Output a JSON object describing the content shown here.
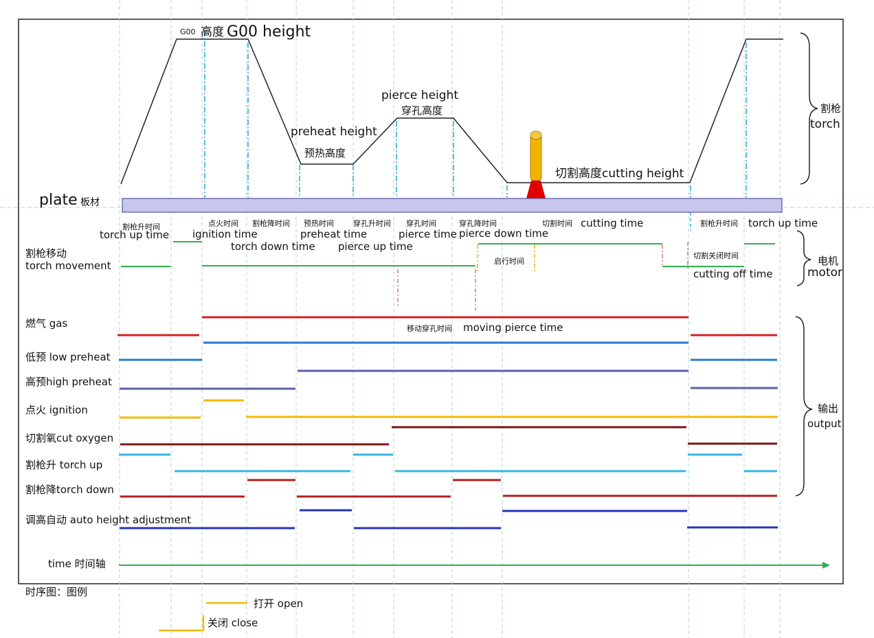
{
  "colors": {
    "profile": "#222222",
    "grid": "#a8d8cc",
    "plate_fill": "#c7c7ee",
    "plate_stroke": "#555599",
    "marker_blue": "#29a3d6",
    "marker_yellow": "#f2b200",
    "marker_red": "#e05050",
    "motor": "#2fb04a",
    "gas": "#d42020",
    "low_preheat": "#2a79c7",
    "high_preheat": "#5b5fa8",
    "ignition": "#f5b800",
    "cut_oxygen": "#7a1515",
    "torch_up": "#33b6e0",
    "torch_down": "#b01e1e",
    "auto_height": "#2433b8",
    "time_axis": "#2fb04a"
  },
  "top": {
    "g00_small": "G00",
    "g00_cn": "高度",
    "g00_en": "G00 height",
    "pierce_en": "pierce height",
    "pierce_cn": "穿孔高度",
    "preheat_en": "preheat height",
    "preheat_cn": "预热高度",
    "cutting_height": "切割高度cutting height",
    "plate_en": "plate",
    "plate_cn": "板材"
  },
  "phases": {
    "up_cn": "割枪升时间",
    "up_en": "torch up time",
    "ign_cn": "点火时间",
    "ign_en": "ignition time",
    "down_cn": "割枪降时间",
    "down_en": "torch down time",
    "preheat_cn": "预热时间",
    "preheat_en": "preheat time",
    "pup_cn": "穿孔升时间",
    "pup_en": "pierce up time",
    "pierce_cn": "穿孔时间",
    "pierce_en": "pierce time",
    "pdown_cn": "穿孔降时间",
    "pdown_en": "pierce down time",
    "cut_cn": "切割时间",
    "cut_en": "cutting time",
    "up2_cn": "割枪升时间",
    "up2_en": "torch up time",
    "startup_cn": "启行时间",
    "cutoff_cn": "切割关闭时间",
    "cutoff_en": "cutting off time",
    "moving_cn": "移动穿孔时间",
    "moving_en": "moving pierce time"
  },
  "signals": {
    "motor_cn": "割枪移动",
    "motor_en": "torch movement",
    "gas": "燃气 gas",
    "low": "低预 low preheat",
    "high": "高预high preheat",
    "ign": "点火 ignition",
    "cut": "切割氧cut oxygen",
    "up": "割枪升 torch up",
    "down": "割枪降torch down",
    "auto": "调高自动 auto height adjustment",
    "time": "time 时间轴"
  },
  "groups": {
    "torch_cn": "割枪",
    "torch_en": "torch",
    "motor_cn": "电机",
    "motor_en": "motor",
    "output_cn": "输出",
    "output_en": "output"
  },
  "legend": {
    "title": "时序图：图例",
    "open": "打开 open",
    "close": "关闭 close"
  }
}
